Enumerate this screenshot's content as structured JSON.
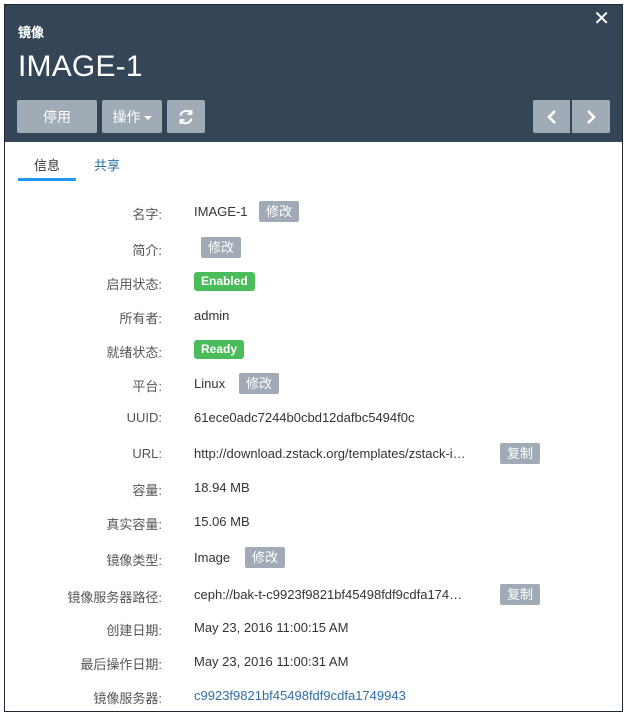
{
  "header": {
    "breadcrumb": "镜像",
    "title": "IMAGE-1",
    "buttons": {
      "disable": "停用",
      "operations": "操作"
    }
  },
  "tabs": [
    {
      "label": "信息",
      "active": true
    },
    {
      "label": "共享",
      "active": false
    }
  ],
  "details": {
    "name_label": "名字:",
    "name_value": "IMAGE-1",
    "description_label": "简介:",
    "enable_state_label": "启用状态:",
    "enable_state_value": "Enabled",
    "owner_label": "所有者:",
    "owner_value": "admin",
    "ready_state_label": "就绪状态:",
    "ready_state_value": "Ready",
    "platform_label": "平台:",
    "platform_value": "Linux",
    "uuid_label": "UUID:",
    "uuid_value": "61ece0adc7244b0cbd12dafbc5494f0c",
    "url_label": "URL:",
    "url_value": "http://download.zstack.org/templates/zstack-i…",
    "size_label": "容量:",
    "size_value": "18.94 MB",
    "actual_size_label": "真实容量:",
    "actual_size_value": "15.06 MB",
    "media_type_label": "镜像类型:",
    "media_type_value": "Image",
    "backup_path_label": "镜像服务器路径:",
    "backup_path_value": "ceph://bak-t-c9923f9821bf45498fdf9cdfa174…",
    "created_label": "创建日期:",
    "created_value": "May 23, 2016 11:00:15 AM",
    "last_op_label": "最后操作日期:",
    "last_op_value": "May 23, 2016 11:00:31 AM",
    "backup_storage_label": "镜像服务器:",
    "backup_storage_value": "c9923f9821bf45498fdf9cdfa1749943"
  },
  "actions": {
    "edit": "修改",
    "copy": "复制"
  },
  "colors": {
    "header_bg": "#344558",
    "button_bg": "#a0abb6",
    "badge_green": "#4bbc5a",
    "link_blue": "#2f6fa6",
    "tab_underline": "#2196f3"
  },
  "icons": [
    "close-icon",
    "refresh-icon",
    "chevron-down-icon",
    "chevron-left-icon",
    "chevron-right-icon"
  ]
}
